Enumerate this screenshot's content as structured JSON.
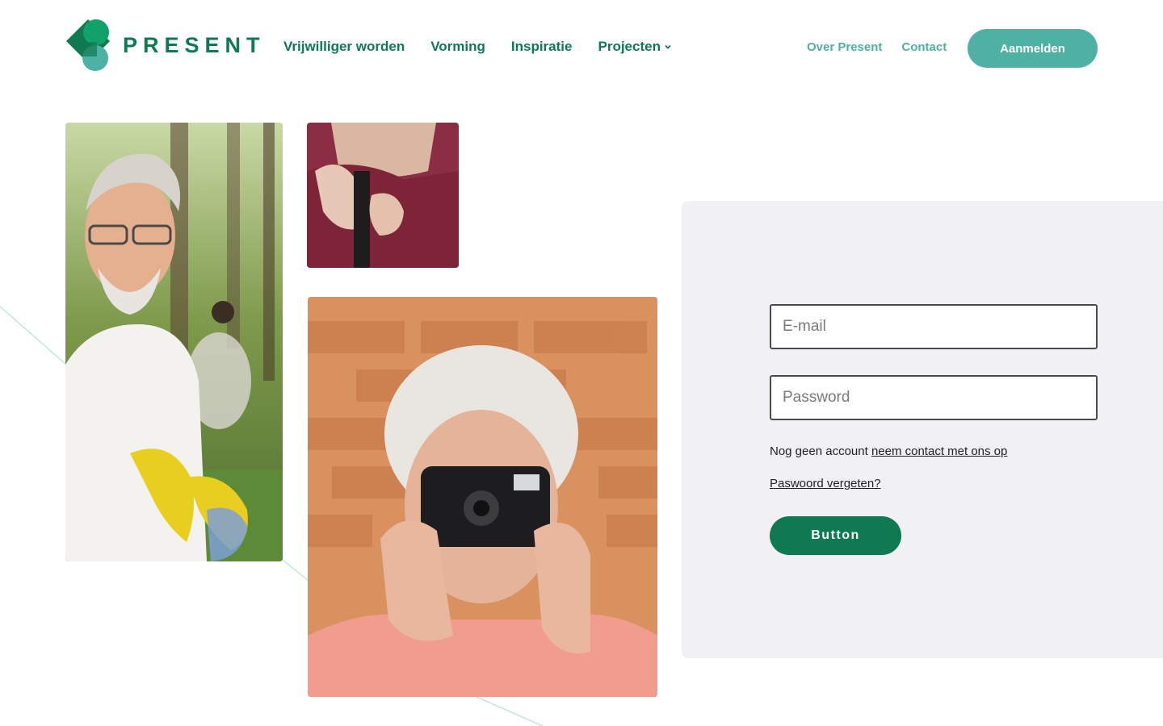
{
  "brand": {
    "name": "PRESENT",
    "colors": {
      "primary": "#0f7a52",
      "accent": "#4fb0a4",
      "panel": "#f0f0f5"
    }
  },
  "nav": {
    "items": [
      {
        "label": "Vrijwilliger worden"
      },
      {
        "label": "Vorming"
      },
      {
        "label": "Inspiratie"
      },
      {
        "label": "Projecten",
        "icon": "chevron-down-icon"
      }
    ],
    "secondary": [
      {
        "label": "Over Present"
      },
      {
        "label": "Contact"
      }
    ],
    "cta_label": "Aanmelden"
  },
  "login": {
    "email_placeholder": "E-mail",
    "password_placeholder": "Password",
    "no_account_text": "Nog geen account",
    "contact_link": "neem contact met ons op",
    "forgot_link": "Paswoord vergeten?",
    "submit_label": "Button"
  }
}
